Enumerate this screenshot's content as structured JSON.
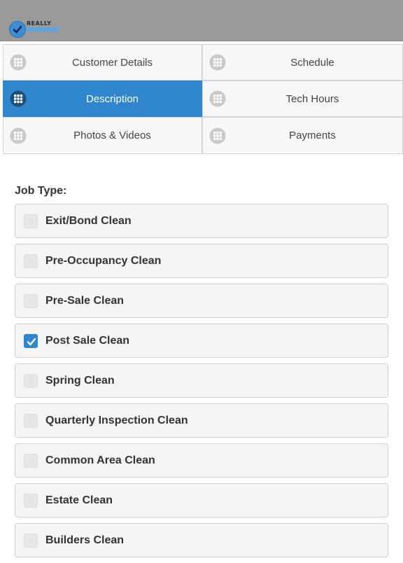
{
  "app": {
    "logo_text": "REALLY"
  },
  "tabs": [
    {
      "label": "Customer Details",
      "active": false
    },
    {
      "label": "Schedule",
      "active": false
    },
    {
      "label": "Description",
      "active": true
    },
    {
      "label": "Tech Hours",
      "active": false
    },
    {
      "label": "Photos & Videos",
      "active": false
    },
    {
      "label": "Payments",
      "active": false
    }
  ],
  "tab_icon": "grid-icon",
  "job_type": {
    "label": "Job Type:",
    "options": [
      {
        "label": "Exit/Bond Clean",
        "checked": false
      },
      {
        "label": "Pre-Occupancy Clean",
        "checked": false
      },
      {
        "label": "Pre-Sale Clean",
        "checked": false
      },
      {
        "label": "Post Sale Clean",
        "checked": true
      },
      {
        "label": "Spring Clean",
        "checked": false
      },
      {
        "label": "Quarterly Inspection Clean",
        "checked": false
      },
      {
        "label": "Common Area Clean",
        "checked": false
      },
      {
        "label": "Estate Clean",
        "checked": false
      },
      {
        "label": "Builders Clean",
        "checked": false
      }
    ]
  },
  "colors": {
    "accent": "#2f86cc",
    "topbar": "#9a9a9a"
  }
}
